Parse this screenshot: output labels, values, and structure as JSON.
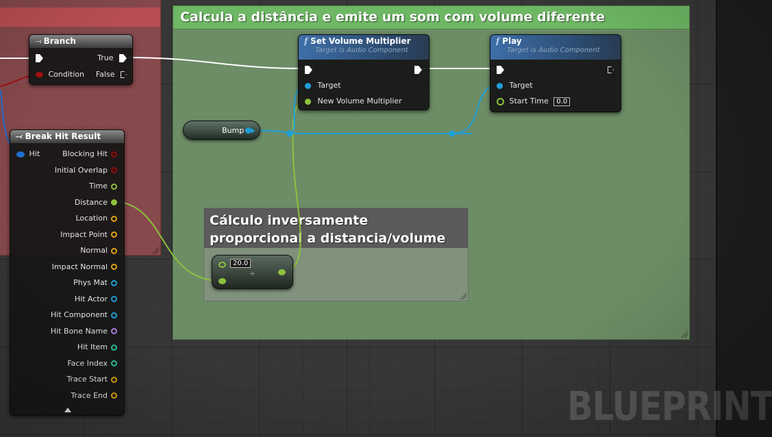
{
  "comments": {
    "green_title": "Calcula a distância e emite um som com volume diferente",
    "grey_title": "Cálculo inversamente proporcional a distancia/volume"
  },
  "branch_node": {
    "title": "Branch",
    "pin_condition": "Condition",
    "pin_true": "True",
    "pin_false": "False"
  },
  "break_hit_node": {
    "title": "Break Hit Result",
    "input_hit": "Hit",
    "outputs": [
      {
        "label": "Blocking Hit",
        "color": "#8a0f0f"
      },
      {
        "label": "Initial Overlap",
        "color": "#8a0f0f"
      },
      {
        "label": "Time",
        "color": "#8ec23e"
      },
      {
        "label": "Distance",
        "color": "#8ec23e"
      },
      {
        "label": "Location",
        "color": "#e2a20f"
      },
      {
        "label": "Impact Point",
        "color": "#e2a20f"
      },
      {
        "label": "Normal",
        "color": "#e2a20f"
      },
      {
        "label": "Impact Normal",
        "color": "#e2a20f"
      },
      {
        "label": "Phys Mat",
        "color": "#1f9fd8"
      },
      {
        "label": "Hit Actor",
        "color": "#1f9fd8"
      },
      {
        "label": "Hit Component",
        "color": "#1f9fd8"
      },
      {
        "label": "Hit Bone Name",
        "color": "#b07cd8"
      },
      {
        "label": "Hit Item",
        "color": "#2bc39a"
      },
      {
        "label": "Face Index",
        "color": "#2bc39a"
      },
      {
        "label": "Trace Start",
        "color": "#e2a20f"
      },
      {
        "label": "Trace End",
        "color": "#e2a20f"
      }
    ]
  },
  "set_volume_node": {
    "title": "Set Volume Multiplier",
    "subtitle": "Target is Audio Component",
    "pin_target": "Target",
    "pin_new_volume": "New Volume Multiplier"
  },
  "play_node": {
    "title": "Play",
    "subtitle": "Target is Audio Component",
    "pin_target": "Target",
    "pin_start_time": "Start Time",
    "start_time_value": "0.0"
  },
  "bump_node": {
    "label": "Bump"
  },
  "divide_node": {
    "value": "20.0"
  },
  "watermark": "BLUEPRINT",
  "colors": {
    "exec": "#ffffff",
    "float": "#8ec23e",
    "object": "#1f9fd8",
    "bool": "#8a0f0f",
    "struct": "#e2a20f"
  }
}
